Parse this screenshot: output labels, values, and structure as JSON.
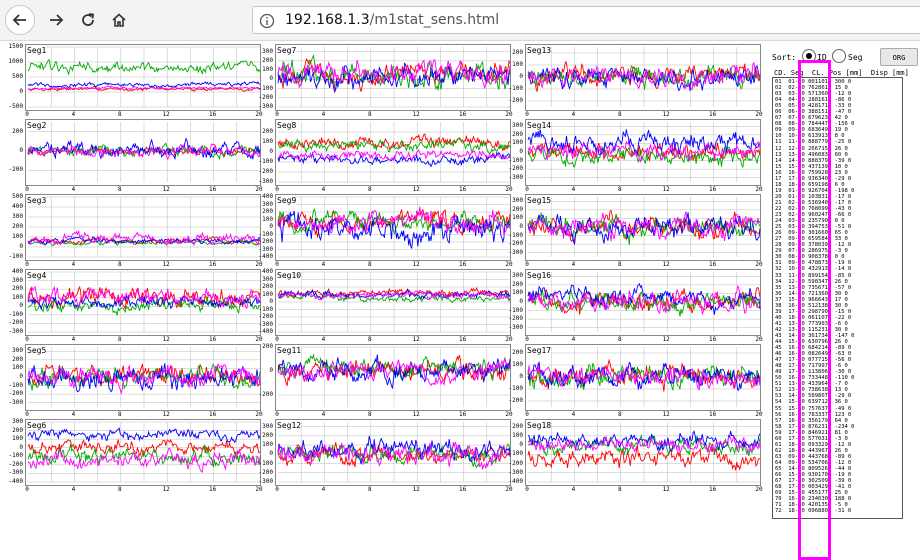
{
  "browser": {
    "url_host": "192.168.1.3",
    "url_path": "/m1stat_sens.html",
    "icons": [
      "back-arrow-icon",
      "forward-arrow-icon",
      "reload-icon",
      "home-icon",
      "info-icon"
    ]
  },
  "colors": {
    "series": [
      "#ff0000",
      "#00aa00",
      "#0000ff",
      "#ff00ff"
    ],
    "highlight": "#ff00ff",
    "grid": "#bbbbbb"
  },
  "panels": [
    {
      "label": "Seg1",
      "yticks": [
        "1500",
        "1000",
        "500",
        "0",
        "-500"
      ],
      "ymin": -500,
      "ymax": 1500,
      "xticks": [
        "0",
        "4",
        "8",
        "12",
        "16",
        "20"
      ],
      "baselines": [
        100,
        800,
        250,
        120
      ],
      "amps": [
        70,
        220,
        90,
        60
      ]
    },
    {
      "label": "Seg2",
      "yticks": [
        "200",
        "0",
        "-200"
      ],
      "ymin": -320,
      "ymax": 300,
      "xticks": [
        "0",
        "4",
        "8",
        "12",
        "16",
        "20"
      ],
      "baselines": [
        0,
        0,
        10,
        0
      ],
      "amps": [
        60,
        60,
        90,
        70
      ]
    },
    {
      "label": "Seg3",
      "yticks": [
        "500",
        "400",
        "300",
        "200",
        "100",
        "0",
        "-100"
      ],
      "ymin": -100,
      "ymax": 500,
      "xticks": [
        "0",
        "4",
        "8",
        "12",
        "16",
        "20"
      ],
      "baselines": [
        60,
        40,
        60,
        80
      ],
      "amps": [
        30,
        25,
        35,
        60
      ]
    },
    {
      "label": "Seg4",
      "yticks": [
        "400",
        "300",
        "200",
        "100",
        "0",
        "-100",
        "-200",
        "-300"
      ],
      "ymin": -300,
      "ymax": 400,
      "xticks": [
        "0",
        "4",
        "8",
        "12",
        "16",
        "20"
      ],
      "baselines": [
        100,
        0,
        50,
        100
      ],
      "amps": [
        140,
        90,
        90,
        120
      ]
    },
    {
      "label": "Seg5",
      "yticks": [
        "300",
        "200",
        "100",
        "0",
        "-100",
        "-200",
        "-300"
      ],
      "ymin": -350,
      "ymax": 350,
      "xticks": [
        "0",
        "4",
        "8",
        "12",
        "16",
        "20"
      ],
      "baselines": [
        0,
        0,
        0,
        0
      ],
      "amps": [
        140,
        140,
        160,
        150
      ]
    },
    {
      "label": "Seg6",
      "yticks": [
        "300",
        "200",
        "100",
        "0",
        "-100",
        "-200",
        "-300",
        "-400"
      ],
      "ymin": -400,
      "ymax": 300,
      "xticks": [
        "0",
        "4",
        "8",
        "12",
        "16",
        "20"
      ],
      "baselines": [
        0,
        -100,
        150,
        -150
      ],
      "amps": [
        100,
        120,
        80,
        120
      ]
    },
    {
      "label": "Seg7",
      "yticks": [
        "300",
        "200",
        "100",
        "0",
        "-100",
        "-200",
        "-300"
      ],
      "ymin": -300,
      "ymax": 350,
      "xticks": [
        "0",
        "4",
        "8",
        "12",
        "16",
        "20"
      ],
      "baselines": [
        50,
        50,
        0,
        50
      ],
      "amps": [
        150,
        150,
        150,
        150
      ]
    },
    {
      "label": "Seg8",
      "yticks": [
        "200",
        "100",
        "0",
        "-100",
        "-200",
        "-300"
      ],
      "ymin": -300,
      "ymax": 300,
      "xticks": [
        "0",
        "4",
        "8",
        "12",
        "16",
        "20"
      ],
      "baselines": [
        100,
        70,
        -70,
        -40
      ],
      "amps": [
        80,
        70,
        60,
        60
      ]
    },
    {
      "label": "Seg9",
      "yticks": [
        "400",
        "300",
        "200",
        "100",
        "0",
        "-100",
        "-200",
        "-300",
        "-400"
      ],
      "ymin": -400,
      "ymax": 400,
      "xticks": [
        "0",
        "4",
        "8",
        "12",
        "16",
        "20"
      ],
      "baselines": [
        50,
        80,
        -20,
        40
      ],
      "amps": [
        180,
        150,
        220,
        180
      ]
    },
    {
      "label": "Seg10",
      "yticks": [
        "400",
        "300",
        "200",
        "100",
        "0",
        "-100",
        "-200",
        "-300",
        "-400"
      ],
      "ymin": -400,
      "ymax": 400,
      "xticks": [
        "0",
        "4",
        "8",
        "12",
        "16",
        "20"
      ],
      "baselines": [
        120,
        60,
        100,
        90
      ],
      "amps": [
        60,
        60,
        60,
        60
      ]
    },
    {
      "label": "Seg11",
      "yticks": [
        "200",
        "0",
        "-200"
      ],
      "ymin": -300,
      "ymax": 200,
      "xticks": [
        "0",
        "4",
        "8",
        "12",
        "16",
        "20"
      ],
      "baselines": [
        0,
        30,
        0,
        -10
      ],
      "amps": [
        100,
        90,
        110,
        100
      ]
    },
    {
      "label": "Seg12",
      "yticks": [
        "300",
        "200",
        "100",
        "0",
        "-100",
        "-200",
        "-300"
      ],
      "ymin": -300,
      "ymax": 350,
      "xticks": [
        "0",
        "4",
        "8",
        "12",
        "16",
        "20"
      ],
      "baselines": [
        0,
        0,
        50,
        0
      ],
      "amps": [
        120,
        120,
        130,
        140
      ]
    },
    {
      "label": "Seg13",
      "yticks": [
        "200",
        "100",
        "0",
        "-100",
        "-200"
      ],
      "ymin": -250,
      "ymax": 250,
      "xticks": [
        "0",
        "4",
        "8",
        "12",
        "16",
        "20"
      ],
      "baselines": [
        0,
        0,
        0,
        0
      ],
      "amps": [
        100,
        100,
        110,
        110
      ]
    },
    {
      "label": "Seg14",
      "yticks": [
        "300",
        "200",
        "100",
        "0",
        "-100",
        "-200",
        "-300"
      ],
      "ymin": -350,
      "ymax": 350,
      "xticks": [
        "0",
        "4",
        "8",
        "12",
        "16",
        "20"
      ],
      "baselines": [
        0,
        -50,
        100,
        0
      ],
      "amps": [
        130,
        130,
        140,
        120
      ]
    },
    {
      "label": "Seg15",
      "yticks": [
        "300",
        "200",
        "100",
        "0",
        "-100",
        "-200",
        "-300"
      ],
      "ymin": -350,
      "ymax": 350,
      "xticks": [
        "0",
        "4",
        "8",
        "12",
        "16",
        "20"
      ],
      "baselines": [
        0,
        0,
        0,
        0
      ],
      "amps": [
        140,
        140,
        150,
        150
      ]
    },
    {
      "label": "Seg16",
      "yticks": [
        "300",
        "200",
        "100",
        "0",
        "-100",
        "-200",
        "-300"
      ],
      "ymin": -350,
      "ymax": 350,
      "xticks": [
        "0",
        "4",
        "8",
        "12",
        "16",
        "20"
      ],
      "baselines": [
        0,
        0,
        50,
        0
      ],
      "amps": [
        140,
        140,
        140,
        140
      ]
    },
    {
      "label": "Seg17",
      "yticks": [
        "200",
        "100",
        "0",
        "-100",
        "-200"
      ],
      "ymin": -250,
      "ymax": 250,
      "xticks": [
        "0",
        "4",
        "8",
        "12",
        "16",
        "20"
      ],
      "baselines": [
        0,
        0,
        0,
        0
      ],
      "amps": [
        110,
        110,
        110,
        110
      ]
    },
    {
      "label": "Seg18",
      "yticks": [
        "200",
        "100",
        "0",
        "-100",
        "-200",
        "-300",
        "-400"
      ],
      "ymin": -400,
      "ymax": 250,
      "xticks": [
        "0",
        "4",
        "8",
        "12",
        "16",
        "20"
      ],
      "baselines": [
        -150,
        0,
        50,
        0
      ],
      "amps": [
        120,
        100,
        100,
        100
      ]
    }
  ],
  "sort": {
    "label": "Sort:",
    "option_id": "ID",
    "option_seg": "Seg",
    "selected": "ID",
    "org_button": "ORG"
  },
  "table": {
    "header": "CD. Seg  CL. Pos [mm]  Disp [mm]",
    "rows": [
      "01  01- 0 001101  300 0",
      "02  02- 0 762861  15 0",
      "03  03- 0 571360  -12 0",
      "04  04- 0 288161  -86 0",
      "05  05- 0 428171  -33 0",
      "06  06- 0 388151  -47 0",
      "07  07- 0 679623  42 0",
      "08  08- 0 784447  -156 0",
      "09  09- 0 683649  19 0",
      "10  10- 0 613913  8 0",
      "11  11- 0 888779  -25 0",
      "12  12- 0 266715  26 0",
      "13  13- 0 496083  60 0",
      "14  14- 0 888379  -39 0",
      "15  15- 0 437139  10 0",
      "16  16- 0 759928  23 0",
      "17  17- 0 936340  -29 0",
      "18  18- 0 659198  6 0",
      "19  01- 0 926704  -198 0",
      "20  01- 0 103831  -17 0",
      "21  02- 0 536940  -17 0",
      "22  02- 0 768099  -43 0",
      "23  02- 0 960247  -66 0",
      "24  03- 0 235790  0 0",
      "25  03- 0 394753  -51 0",
      "26  09- 0 301660  65 0",
      "27  09- 0 659584  33 0",
      "28  09- 0 378039  -12 0",
      "29  07- 0 286975  -3 0",
      "30  08- 0 908378  0 0",
      "31  09- 0 478873  -19 0",
      "32  10- 0 432913  -14 0",
      "33  11- 0 899154  -85 0",
      "34  12- 0 590347  26 0",
      "35  13- 0 735671  -57 0",
      "36  14- 0 721360  30 0",
      "37  15- 0 966643  17 0",
      "38  16- 0 512138  30 0",
      "39  17- 0 298790  -15 0",
      "40  18- 0 061107  -22 0",
      "41  13- 0 773903  -6 0",
      "42  13- 0 115231  30 0",
      "43  14- 0 361734  -147 0",
      "44  15- 0 630796  26 0",
      "45  16- 0 684214  -89 0",
      "46  16- 0 082649  -63 0",
      "47  17- 0 077715  -56 0",
      "48  17- 0 717997  -6 0",
      "49  17- 0 113806  -30 0",
      "50  16- 0 733448  -110 0",
      "51  13- 0 433964  -7 0",
      "52  13- 0 738638  13 0",
      "53  14- 0 509807  -29 0",
      "54  15- 0 639712  36 0",
      "55  15- 0 757637  -49 0",
      "56  16- 0 783337  123 0",
      "57  16- 0 356179  64 0",
      "58  17- 0 876231  -234 0",
      "59  17- 0 846921  81 0",
      "60  17- 0 577031  -3 0",
      "61  18- 0 093329  -12 0",
      "62  18- 0 443967  26 0",
      "63  09- 0 443768  -89 0",
      "64  09- 0 534706  -12 0",
      "65  14- 0 809526  -44 0",
      "66  15- 0 930170  -19 0",
      "67  17- 0 302509  -39 0",
      "68  17- 0 003429  -41 0",
      "69  15- 0 455177  25 0",
      "70  16- 0 234030  188 0",
      "71  18- 0 420135  -5 0",
      "72  18- 0 096880  -31 0"
    ]
  }
}
